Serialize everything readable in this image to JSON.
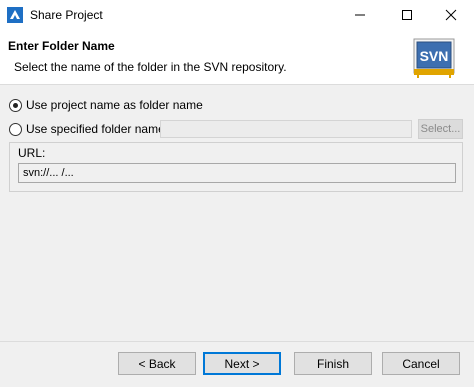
{
  "window": {
    "title": "Share Project",
    "app_icon": "eclipse-share-icon",
    "controls": [
      "minimize-icon",
      "maximize-icon",
      "close-icon"
    ]
  },
  "banner": {
    "title": "Enter Folder Name",
    "description": "Select the name of the folder in the SVN repository.",
    "logo_text": "SVN"
  },
  "options": {
    "use_project_name": {
      "label": "Use project name as folder name",
      "checked": true
    },
    "use_specified_name": {
      "label": "Use specified folder name:",
      "checked": false
    },
    "folder_name_value": "",
    "select_button": "Select..."
  },
  "url": {
    "label": "URL:",
    "value": "svn://... /..."
  },
  "footer": {
    "back": "< Back",
    "next": "Next >",
    "finish": "Finish",
    "cancel": "Cancel"
  },
  "colors": {
    "window_bg": "#f0f0f0",
    "banner_bg": "#ffffff",
    "accent": "#0078d7",
    "svn_gold": "#e0a400"
  }
}
